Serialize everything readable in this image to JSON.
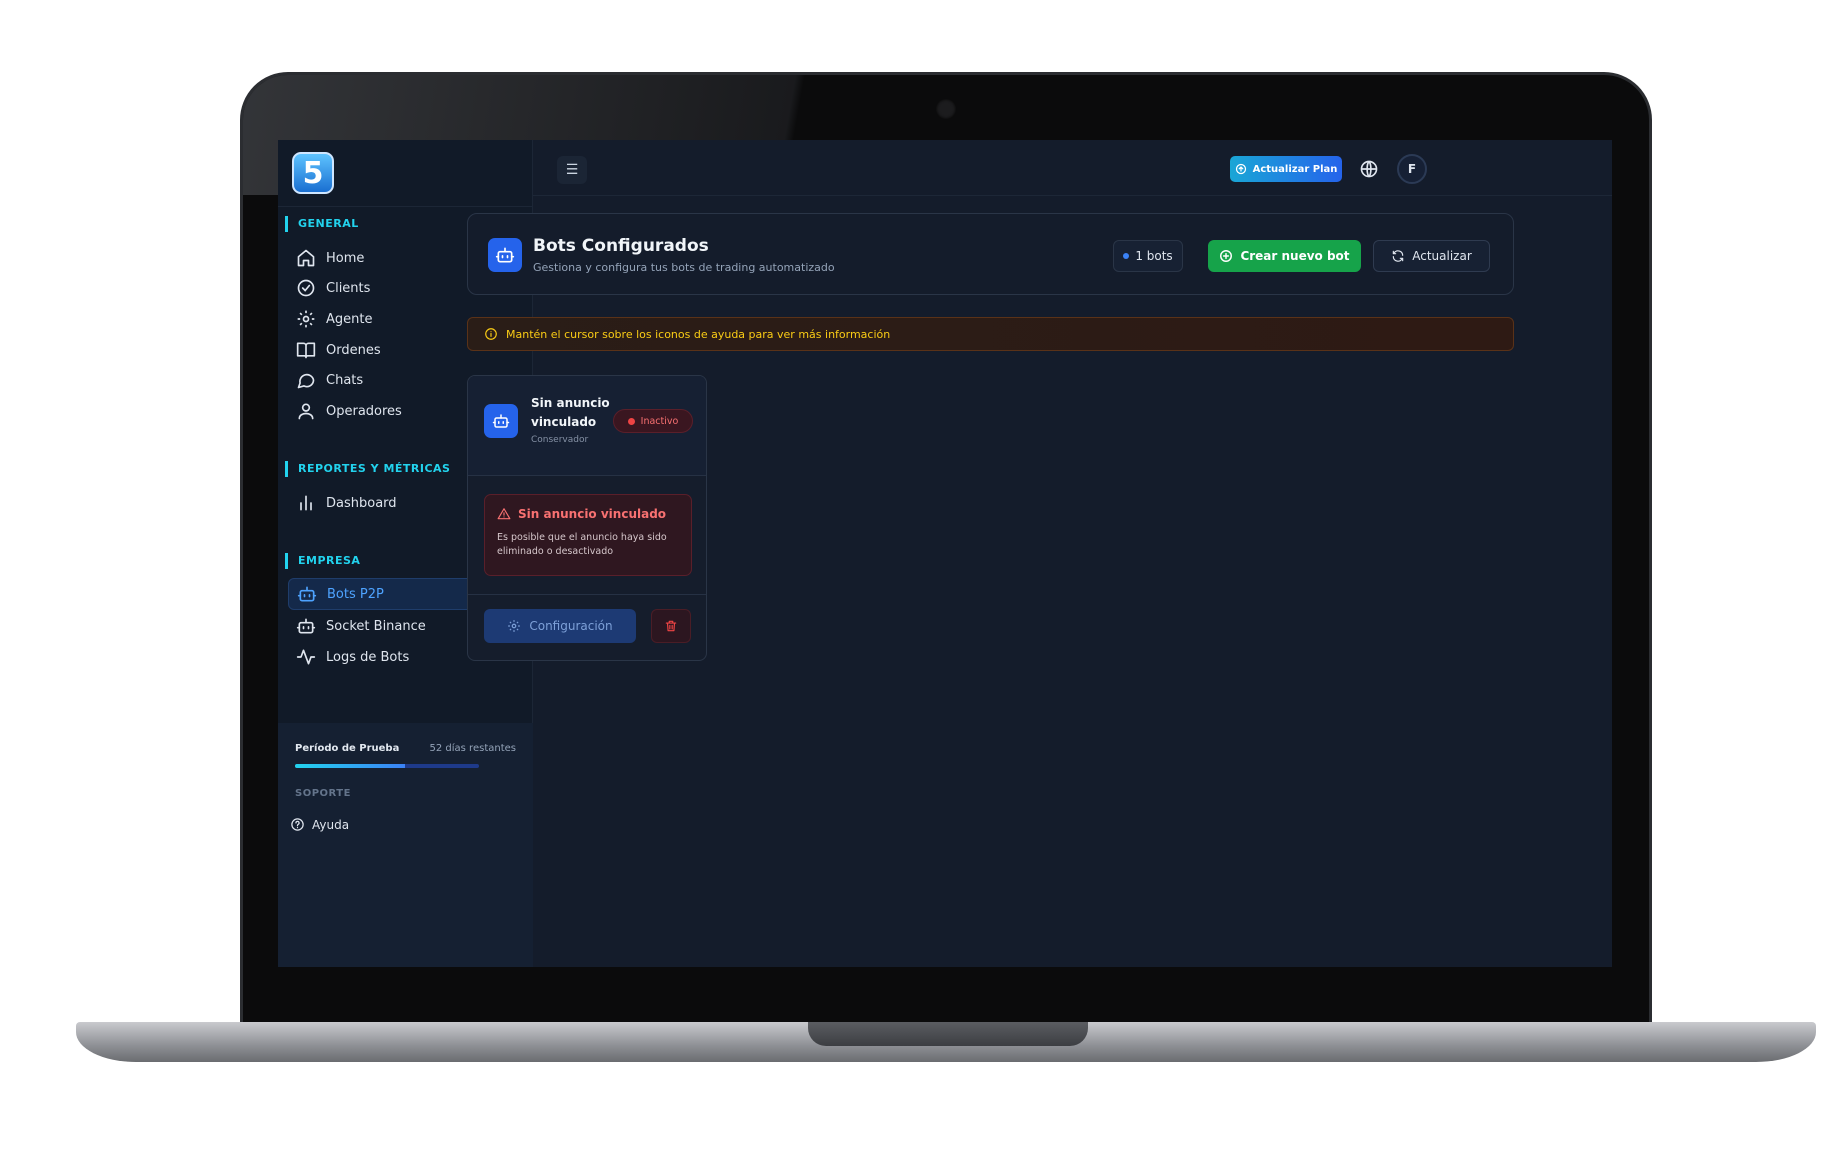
{
  "app": {
    "logo_text": "5"
  },
  "sidebar": {
    "sections": [
      {
        "title": "GENERAL",
        "items": [
          {
            "label": "Home",
            "icon": "home-icon"
          },
          {
            "label": "Clients",
            "icon": "check-circle-icon"
          },
          {
            "label": "Agente",
            "icon": "gear-icon"
          },
          {
            "label": "Ordenes",
            "icon": "book-icon"
          },
          {
            "label": "Chats",
            "icon": "chat-bubble-icon"
          },
          {
            "label": "Operadores",
            "icon": "user-icon"
          }
        ]
      },
      {
        "title": "REPORTES Y MÉTRICAS",
        "items": [
          {
            "label": "Dashboard",
            "icon": "bar-chart-icon"
          }
        ]
      },
      {
        "title": "EMPRESA",
        "items": [
          {
            "label": "Bots P2P",
            "icon": "bot-icon",
            "active": true
          },
          {
            "label": "Socket Binance",
            "icon": "bot-icon"
          },
          {
            "label": "Logs de Bots",
            "icon": "activity-icon"
          }
        ]
      }
    ],
    "trial": {
      "label": "Período de Prueba",
      "days_left": "52 días restantes",
      "progress": 0.6
    },
    "support": {
      "title": "SOPORTE",
      "help_label": "Ayuda"
    }
  },
  "topbar": {
    "upgrade_label": "Actualizar Plan",
    "avatar_initial": "F"
  },
  "header": {
    "title": "Bots Configurados",
    "subtitle": "Gestiona y configura tus bots de trading automatizado",
    "count_label": "1 bots",
    "create_label": "Crear nuevo bot",
    "refresh_label": "Actualizar"
  },
  "hint": {
    "text": "Mantén el cursor sobre los iconos de ayuda para ver más información"
  },
  "bot_card": {
    "name": "Sin anuncio vinculado",
    "type": "Conservador",
    "status": "Inactivo",
    "alert_title": "Sin anuncio vinculado",
    "alert_text": "Es posible que el anuncio haya sido eliminado o desactivado",
    "config_label": "Configuración"
  },
  "colors": {
    "accent": "#22d3ee",
    "primary": "#2563eb",
    "success": "#16a34a",
    "danger": "#ef4444",
    "warning": "#facc15"
  }
}
